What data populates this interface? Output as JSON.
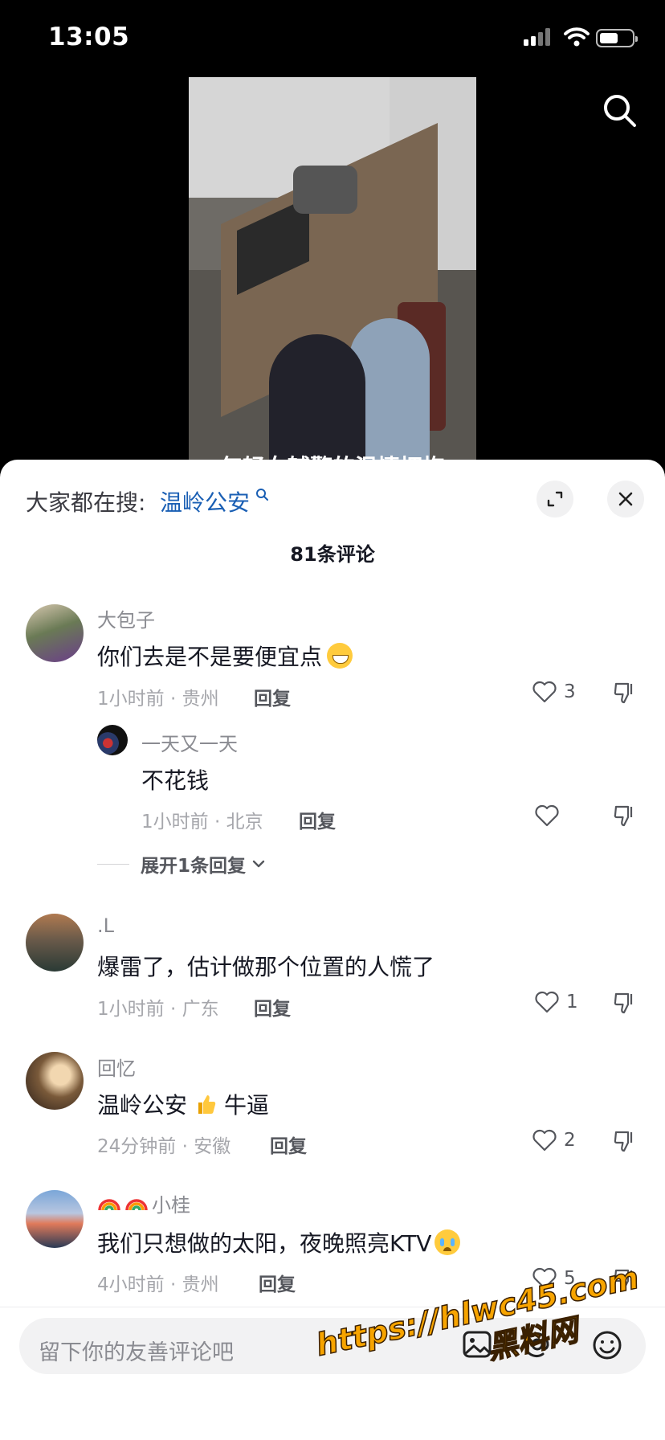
{
  "status_bar": {
    "time": "13:05"
  },
  "video": {
    "caption_peek": "年轻女辅警的温情拥抱"
  },
  "trending": {
    "label": "大家都在搜:",
    "term": "温岭公安"
  },
  "comments_header": {
    "count_label": "81条评论"
  },
  "comments": [
    {
      "username": "大包子",
      "text": "你们去是不是要便宜点",
      "emoji": "grin",
      "meta": "1小时前 · 贵州",
      "reply_label": "回复",
      "likes": "3"
    },
    {
      "username": ".L",
      "text": "爆雷了，估计做那个位置的人慌了",
      "meta": "1小时前 · 广东",
      "reply_label": "回复",
      "likes": "1"
    },
    {
      "username": "回忆",
      "text_before": "温岭公安",
      "text_after": "牛逼",
      "meta": "24分钟前 · 安徽",
      "reply_label": "回复",
      "likes": "2"
    },
    {
      "username": "小桂",
      "text": "我们只想做的太阳，夜晚照亮KTV",
      "emoji": "cry",
      "meta": "4小时前 · 贵州",
      "reply_label": "回复",
      "likes": "5"
    }
  ],
  "reply": {
    "username": "一天又一天",
    "text": "不花钱",
    "meta": "1小时前 · 北京",
    "reply_label": "回复",
    "likes": ""
  },
  "expand_replies": {
    "label": "展开1条回复"
  },
  "input": {
    "placeholder": "留下你的友善评论吧"
  },
  "watermark": {
    "line1": "https://hlwc45.com",
    "line2": "黑料网"
  },
  "colors": {
    "link": "#1a5fb4",
    "sheet_bg": "#ffffff",
    "watermark": "#f7a400"
  }
}
